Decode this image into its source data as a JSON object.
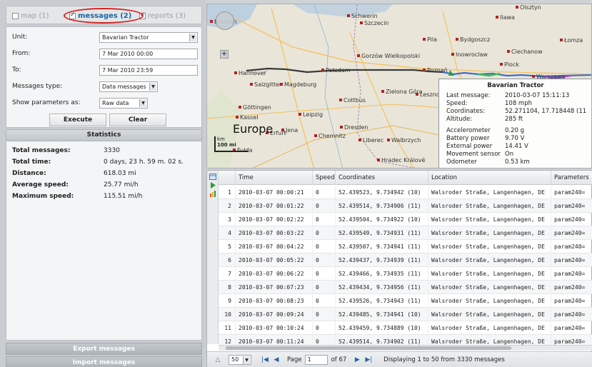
{
  "tabs": [
    {
      "label": "map (1)",
      "checked": false,
      "active": false
    },
    {
      "label": "messages (2)",
      "checked": true,
      "active": true
    },
    {
      "label": "reports (3)",
      "checked": true,
      "active": false
    }
  ],
  "filters": {
    "unit_label": "Unit:",
    "unit_value": "Bavarian Tractor",
    "from_label": "From:",
    "from_value": "7 Mar 2010 00:00",
    "to_label": "To:",
    "to_value": "7 Mar 2010 23:59",
    "type_label": "Messages type:",
    "type_value": "Data messages",
    "params_label": "Show parameters as:",
    "params_value": "Raw data",
    "execute_label": "Execute",
    "clear_label": "Clear"
  },
  "statistics": {
    "title": "Statistics",
    "rows": [
      {
        "key": "Total messages:",
        "value": "3330"
      },
      {
        "key": "Total time:",
        "value": "0 days, 23 h. 59 m. 02 s."
      },
      {
        "key": "Distance:",
        "value": "618.03 mi"
      },
      {
        "key": "Average speed:",
        "value": "25.77 mi/h"
      },
      {
        "key": "Maximum speed:",
        "value": "115.51 mi/h"
      }
    ]
  },
  "actions": {
    "export_label": "Export messages",
    "import_label": "Import messages"
  },
  "map": {
    "europe_label": "Europe",
    "scale_km": "km",
    "scale_mi": "100 mi",
    "cities": [
      {
        "name": "Schwerin"
      },
      {
        "name": "Szczecin"
      },
      {
        "name": "Pila"
      },
      {
        "name": "Bydgoszcz"
      },
      {
        "name": "Ciechanow"
      },
      {
        "name": "Gorzów Wielkopolski"
      },
      {
        "name": "Inowroclaw"
      },
      {
        "name": "Plock"
      },
      {
        "name": "Warszawa"
      },
      {
        "name": "Hannover"
      },
      {
        "name": "Salzgitter"
      },
      {
        "name": "Magdeburg"
      },
      {
        "name": "Potsdam"
      },
      {
        "name": "Poznań"
      },
      {
        "name": "Zielona Góra"
      },
      {
        "name": "Leszno"
      },
      {
        "name": "Cottbus"
      },
      {
        "name": "Göttingen"
      },
      {
        "name": "Kassel"
      },
      {
        "name": "Leipzig"
      },
      {
        "name": "Dresden"
      },
      {
        "name": "Jena"
      },
      {
        "name": "Chemnitz"
      },
      {
        "name": "Liberec"
      },
      {
        "name": "Walbrzych"
      },
      {
        "name": "Hradec Králové"
      },
      {
        "name": "Erfurt"
      },
      {
        "name": "Fulda"
      },
      {
        "name": "Olsztyn"
      },
      {
        "name": "Ilawa"
      },
      {
        "name": "Łomza"
      },
      {
        "name": "Bremen"
      }
    ],
    "popup": {
      "title": "Bavarian Tractor",
      "rows": [
        {
          "k": "Last message:",
          "v": "2010-03-07 15:11:13"
        },
        {
          "k": "Speed:",
          "v": "108 mph"
        },
        {
          "k": "Coordinates:",
          "v": "52.271104, 17.718448 (11"
        },
        {
          "k": "Altitude:",
          "v": "285 ft"
        },
        {
          "k": "Accelerometer",
          "v": "0.20 g"
        },
        {
          "k": "Battery power",
          "v": "9.70 V"
        },
        {
          "k": "External power",
          "v": "14.41 V"
        },
        {
          "k": "Movement sensor",
          "v": "On"
        },
        {
          "k": "Odometer",
          "v": "0.53 km"
        }
      ]
    }
  },
  "grid": {
    "columns": [
      "",
      "Time",
      "Speed",
      "Coordinates",
      "Location",
      "Parameters"
    ],
    "rows": [
      [
        "1",
        "2010-03-07 00:00:21",
        "0",
        "52.439523, 9.734942 (10)",
        "Walsroder Straße, Langenhagen, DE",
        "param240="
      ],
      [
        "2",
        "2010-03-07 00:01:22",
        "0",
        "52.439514, 9.734906 (11)",
        "Walsroder Straße, Langenhagen, DE",
        "param240="
      ],
      [
        "3",
        "2010-03-07 00:02:22",
        "0",
        "52.439504, 9.734922 (10)",
        "Walsroder Straße, Langenhagen, DE",
        "param240="
      ],
      [
        "4",
        "2010-03-07 00:03:22",
        "0",
        "52.439549, 9.734931 (11)",
        "Walsroder Straße, Langenhagen, DE",
        "param240="
      ],
      [
        "5",
        "2010-03-07 00:04:22",
        "0",
        "52.439507, 9.734941 (11)",
        "Walsroder Straße, Langenhagen, DE",
        "param240="
      ],
      [
        "6",
        "2010-03-07 00:05:22",
        "0",
        "52.439437, 9.734939 (11)",
        "Walsroder Straße, Langenhagen, DE",
        "param240="
      ],
      [
        "7",
        "2010-03-07 00:06:22",
        "0",
        "52.439466, 9.734935 (11)",
        "Walsroder Straße, Langenhagen, DE",
        "param240="
      ],
      [
        "8",
        "2010-03-07 00:07:23",
        "0",
        "52.439434, 9.734956 (11)",
        "Walsroder Straße, Langenhagen, DE",
        "param240="
      ],
      [
        "9",
        "2010-03-07 00:08:23",
        "0",
        "52.439526, 9.734943 (11)",
        "Walsroder Straße, Langenhagen, DE",
        "param240="
      ],
      [
        "10",
        "2010-03-07 00:09:24",
        "0",
        "52.439485, 9.734941 (10)",
        "Walsroder Straße, Langenhagen, DE",
        "param240="
      ],
      [
        "11",
        "2010-03-07 00:10:24",
        "0",
        "52.439459, 9.734889 (10)",
        "Walsroder Straße, Langenhagen, DE",
        "param240="
      ],
      [
        "12",
        "2010-03-07 00:11:24",
        "0",
        "52.439514, 9.734902 (11)",
        "Walsroder Straße, Langenhagen, DE",
        "param240="
      ]
    ]
  },
  "pager": {
    "page_size": "50",
    "page_label": "Page",
    "page_value": "1",
    "of_label": "of 67",
    "status": "Displaying 1 to 50 from 3330 messages"
  },
  "colors": {
    "accent": "#1d67a8",
    "highlight_ring": "#d3211f",
    "track": "#3a3a3a"
  }
}
